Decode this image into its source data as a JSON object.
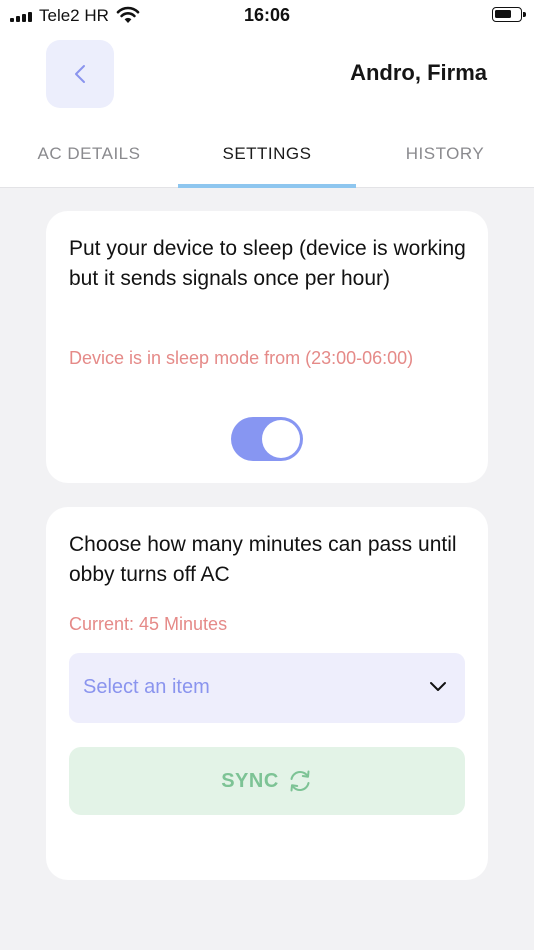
{
  "status_bar": {
    "carrier": "Tele2 HR",
    "time": "16:06",
    "battery_level": 0.7
  },
  "header": {
    "title": "Andro, Firma",
    "back_icon": "chevron-left-icon"
  },
  "tabs": [
    {
      "label": "AC DETAILS",
      "active": false
    },
    {
      "label": "SETTINGS",
      "active": true
    },
    {
      "label": "HISTORY",
      "active": false
    }
  ],
  "sleep_card": {
    "description": "Put your device to sleep (device is working but it sends signals once per hour)",
    "status": "Device is in sleep mode from (23:00-06:00)",
    "toggle_on": true
  },
  "timeout_card": {
    "description": "Choose how many minutes can pass until obby turns off AC",
    "current": "Current: 45 Minutes",
    "select_placeholder": "Select an item",
    "sync_label": "SYNC",
    "sync_icon": "refresh-icon"
  },
  "colors": {
    "accent": "#8796f2",
    "tab_indicator": "#8ec6ef",
    "warning_text": "#e58a88",
    "sync_text": "#7dc395",
    "sync_bg": "#e3f3e7"
  }
}
